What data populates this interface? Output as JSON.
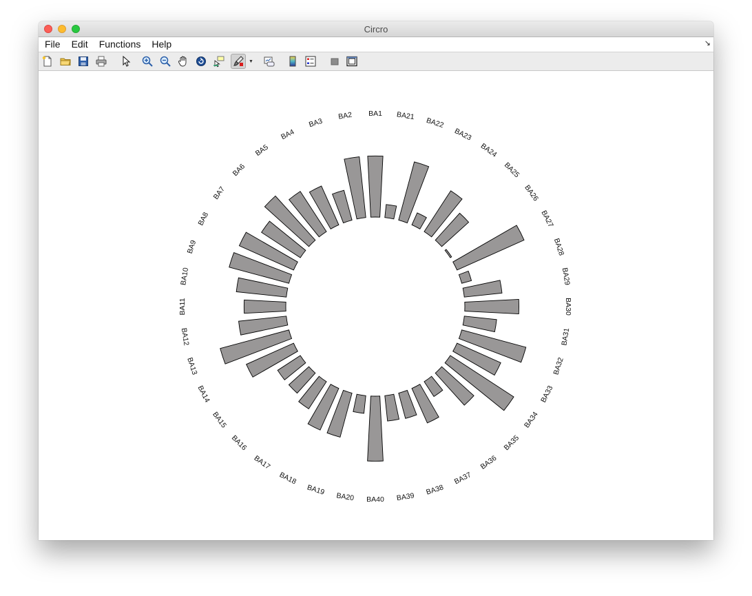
{
  "window": {
    "title": "Circro"
  },
  "menubar": {
    "items": [
      "File",
      "Edit",
      "Functions",
      "Help"
    ]
  },
  "toolbar": {
    "buttons": [
      "new-figure-icon",
      "open-file-icon",
      "save-icon",
      "print-icon",
      "pointer-icon",
      "zoom-in-icon",
      "zoom-out-icon",
      "pan-hand-icon",
      "rotate-3d-icon",
      "data-cursor-icon",
      "brush-icon",
      "link-plot-icon",
      "colorbar-icon",
      "legend-icon",
      "hide-plot-tools-icon",
      "show-plot-tools-icon"
    ]
  },
  "chart_data": {
    "type": "bar",
    "layout": "circular",
    "categories": [
      "BA1",
      "BA21",
      "BA22",
      "BA23",
      "BA24",
      "BA25",
      "BA26",
      "BA27",
      "BA28",
      "BA29",
      "BA30",
      "BA31",
      "BA32",
      "BA33",
      "BA34",
      "BA35",
      "BA36",
      "BA37",
      "BA38",
      "BA39",
      "BA40",
      "BA20",
      "BA19",
      "BA18",
      "BA17",
      "BA16",
      "BA15",
      "BA14",
      "BA13",
      "BA12",
      "BA11",
      "BA10",
      "BA9",
      "BA8",
      "BA7",
      "BA6",
      "BA5",
      "BA4",
      "BA3",
      "BA2"
    ],
    "values": [
      0.79,
      0.17,
      0.78,
      0.17,
      0.63,
      0.47,
      0.02,
      0.95,
      0.13,
      0.49,
      0.7,
      0.42,
      0.86,
      0.62,
      0.98,
      0.56,
      0.23,
      0.49,
      0.34,
      0.33,
      0.84,
      0.23,
      0.59,
      0.59,
      0.42,
      0.35,
      0.35,
      0.67,
      0.92,
      0.62,
      0.54,
      0.65,
      0.8,
      0.77,
      0.6,
      0.77,
      0.62,
      0.55,
      0.4,
      0.79
    ],
    "bar_color": "#999797",
    "edge_color": "#000000"
  }
}
